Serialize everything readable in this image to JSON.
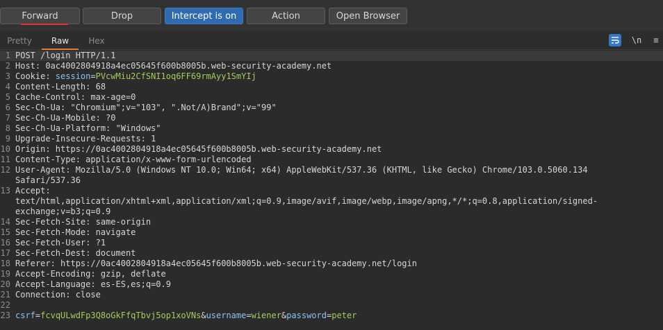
{
  "toolbar": {
    "forward": "Forward",
    "drop": "Drop",
    "intercept": "Intercept is on",
    "action": "Action",
    "open_browser": "Open Browser"
  },
  "tabs": {
    "pretty": "Pretty",
    "raw": "Raw",
    "hex": "Hex"
  },
  "icons": {
    "newline": "\\n",
    "menu": "≡"
  },
  "request": {
    "l1": "POST /login HTTP/1.1",
    "l2": "Host: 0ac4002804918a4ec05645f600b8005b.web-security-academy.net",
    "cookie_key": "Cookie: ",
    "cookie_name": "session",
    "cookie_eq": "=",
    "cookie_val": "PVcwMiu2CfSNI1oq6FF69rmAyy1SmYIj",
    "l4": "Content-Length: 68",
    "l5": "Cache-Control: max-age=0",
    "l6": "Sec-Ch-Ua: \"Chromium\";v=\"103\", \".Not/A)Brand\";v=\"99\"",
    "l7": "Sec-Ch-Ua-Mobile: ?0",
    "l8": "Sec-Ch-Ua-Platform: \"Windows\"",
    "l9": "Upgrade-Insecure-Requests: 1",
    "l10": "Origin: https://0ac4002804918a4ec05645f600b8005b.web-security-academy.net",
    "l11": "Content-Type: application/x-www-form-urlencoded",
    "l12a": "User-Agent: Mozilla/5.0 (Windows NT 10.0; Win64; x64) AppleWebKit/537.36 (KHTML, like Gecko) Chrome/103.0.5060.134",
    "l12b": "Safari/537.36",
    "l13a": "Accept:",
    "l13b": "text/html,application/xhtml+xml,application/xml;q=0.9,image/avif,image/webp,image/apng,*/*;q=0.8,application/signed-",
    "l13c": "exchange;v=b3;q=0.9",
    "l14": "Sec-Fetch-Site: same-origin",
    "l15": "Sec-Fetch-Mode: navigate",
    "l16": "Sec-Fetch-User: ?1",
    "l17": "Sec-Fetch-Dest: document",
    "l18": "Referer: https://0ac4002804918a4ec05645f600b8005b.web-security-academy.net/login",
    "l19": "Accept-Encoding: gzip, deflate",
    "l20": "Accept-Language: es-ES,es;q=0.9",
    "l21": "Connection: close",
    "l22": "",
    "body_csrf_key": "csrf",
    "body_csrf_val": "fcvqULwdFp3Q8oGkFfqTbvj5op1xoVNs",
    "body_user_key": "username",
    "body_user_val": "wiener",
    "body_pass_key": "password",
    "body_pass_val": "peter",
    "amp": "&",
    "eq": "="
  },
  "line_numbers": [
    "1",
    "2",
    "3",
    "4",
    "5",
    "6",
    "7",
    "8",
    "9",
    "10",
    "11",
    "12",
    "13",
    "14",
    "15",
    "16",
    "17",
    "18",
    "19",
    "20",
    "21",
    "22",
    "23"
  ]
}
